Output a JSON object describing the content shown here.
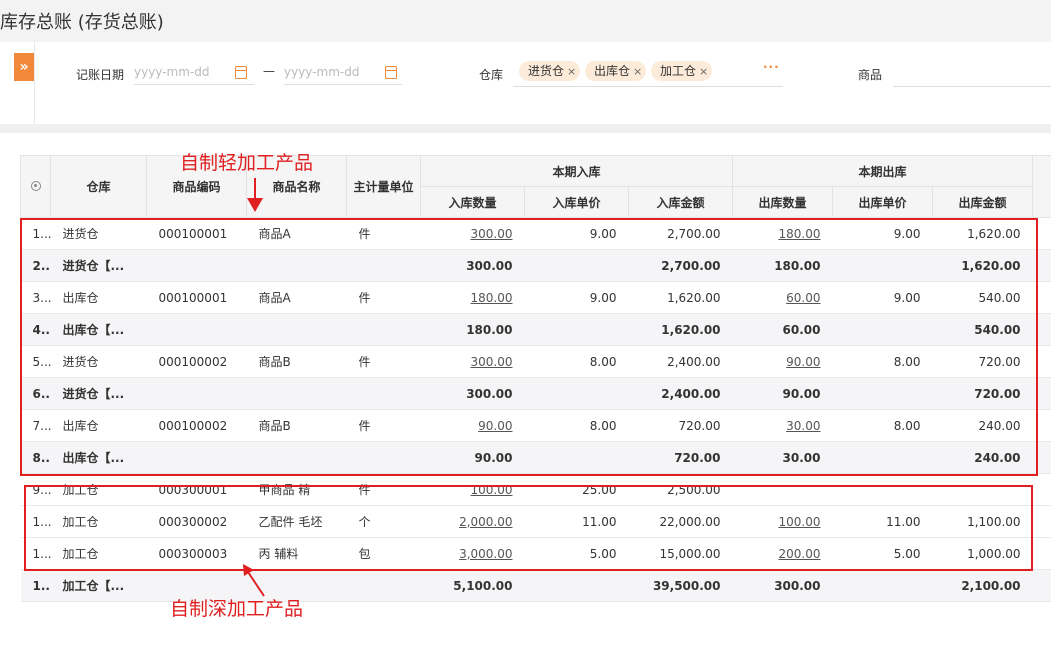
{
  "page": {
    "title": "库存总账 (存货总账)"
  },
  "filter": {
    "expand_glyph": "»",
    "date_label": "记账日期",
    "date_from_placeholder": "yyyy-mm-dd",
    "date_sep": "—",
    "date_to_placeholder": "yyyy-mm-dd",
    "warehouse_label": "仓库",
    "warehouse_tags": [
      "进货仓",
      "出库仓",
      "加工仓"
    ],
    "tag_close": "×",
    "more_label": "···",
    "goods_label": "商品"
  },
  "table": {
    "headers": {
      "warehouse": "仓库",
      "code": "商品编码",
      "name": "商品名称",
      "unit": "主计量单位",
      "group_in": "本期入库",
      "group_out": "本期出库",
      "in_qty": "入库数量",
      "in_price": "入库单价",
      "in_amount": "入库金额",
      "out_qty": "出库数量",
      "out_price": "出库单价",
      "out_amount": "出库金额"
    },
    "rows": [
      {
        "idx": "1...",
        "wh": "进货仓",
        "code": "000100001",
        "name": "商品A",
        "unit": "件",
        "in_qty": "300.00",
        "in_price": "9.00",
        "in_amount": "2,700.00",
        "out_qty": "180.00",
        "out_price": "9.00",
        "out_amount": "1,620.00",
        "sub": false
      },
      {
        "idx": "2...",
        "wh": "进货仓【...",
        "code": "",
        "name": "",
        "unit": "",
        "in_qty": "300.00",
        "in_price": "",
        "in_amount": "2,700.00",
        "out_qty": "180.00",
        "out_price": "",
        "out_amount": "1,620.00",
        "sub": true
      },
      {
        "idx": "3...",
        "wh": "出库仓",
        "code": "000100001",
        "name": "商品A",
        "unit": "件",
        "in_qty": "180.00",
        "in_price": "9.00",
        "in_amount": "1,620.00",
        "out_qty": "60.00",
        "out_price": "9.00",
        "out_amount": "540.00",
        "sub": false
      },
      {
        "idx": "4...",
        "wh": "出库仓【...",
        "code": "",
        "name": "",
        "unit": "",
        "in_qty": "180.00",
        "in_price": "",
        "in_amount": "1,620.00",
        "out_qty": "60.00",
        "out_price": "",
        "out_amount": "540.00",
        "sub": true
      },
      {
        "idx": "5...",
        "wh": "进货仓",
        "code": "000100002",
        "name": "商品B",
        "unit": "件",
        "in_qty": "300.00",
        "in_price": "8.00",
        "in_amount": "2,400.00",
        "out_qty": "90.00",
        "out_price": "8.00",
        "out_amount": "720.00",
        "sub": false
      },
      {
        "idx": "6...",
        "wh": "进货仓【...",
        "code": "",
        "name": "",
        "unit": "",
        "in_qty": "300.00",
        "in_price": "",
        "in_amount": "2,400.00",
        "out_qty": "90.00",
        "out_price": "",
        "out_amount": "720.00",
        "sub": true
      },
      {
        "idx": "7...",
        "wh": "出库仓",
        "code": "000100002",
        "name": "商品B",
        "unit": "件",
        "in_qty": "90.00",
        "in_price": "8.00",
        "in_amount": "720.00",
        "out_qty": "30.00",
        "out_price": "8.00",
        "out_amount": "240.00",
        "sub": false
      },
      {
        "idx": "8...",
        "wh": "出库仓【...",
        "code": "",
        "name": "",
        "unit": "",
        "in_qty": "90.00",
        "in_price": "",
        "in_amount": "720.00",
        "out_qty": "30.00",
        "out_price": "",
        "out_amount": "240.00",
        "sub": true
      },
      {
        "idx": "9...",
        "wh": "加工仓",
        "code": "000300001",
        "name": "甲商品 精",
        "unit": "件",
        "in_qty": "100.00",
        "in_price": "25.00",
        "in_amount": "2,500.00",
        "out_qty": "",
        "out_price": "",
        "out_amount": "",
        "sub": false
      },
      {
        "idx": "1...",
        "wh": "加工仓",
        "code": "000300002",
        "name": "乙配件 毛坯",
        "unit": "个",
        "in_qty": "2,000.00",
        "in_price": "11.00",
        "in_amount": "22,000.00",
        "out_qty": "100.00",
        "out_price": "11.00",
        "out_amount": "1,100.00",
        "sub": false
      },
      {
        "idx": "1...",
        "wh": "加工仓",
        "code": "000300003",
        "name": "丙 辅料",
        "unit": "包",
        "in_qty": "3,000.00",
        "in_price": "5.00",
        "in_amount": "15,000.00",
        "out_qty": "200.00",
        "out_price": "5.00",
        "out_amount": "1,000.00",
        "sub": false
      },
      {
        "idx": "1...",
        "wh": "加工仓【...",
        "code": "",
        "name": "",
        "unit": "",
        "in_qty": "5,100.00",
        "in_price": "",
        "in_amount": "39,500.00",
        "out_qty": "300.00",
        "out_price": "",
        "out_amount": "2,100.00",
        "sub": true
      }
    ]
  },
  "annotations": {
    "light_label": "自制轻加工产品",
    "deep_label": "自制深加工产品",
    "color": "#e02020"
  },
  "colors": {
    "accent": "#f08a3a",
    "tag_bg": "#fdebd9"
  }
}
